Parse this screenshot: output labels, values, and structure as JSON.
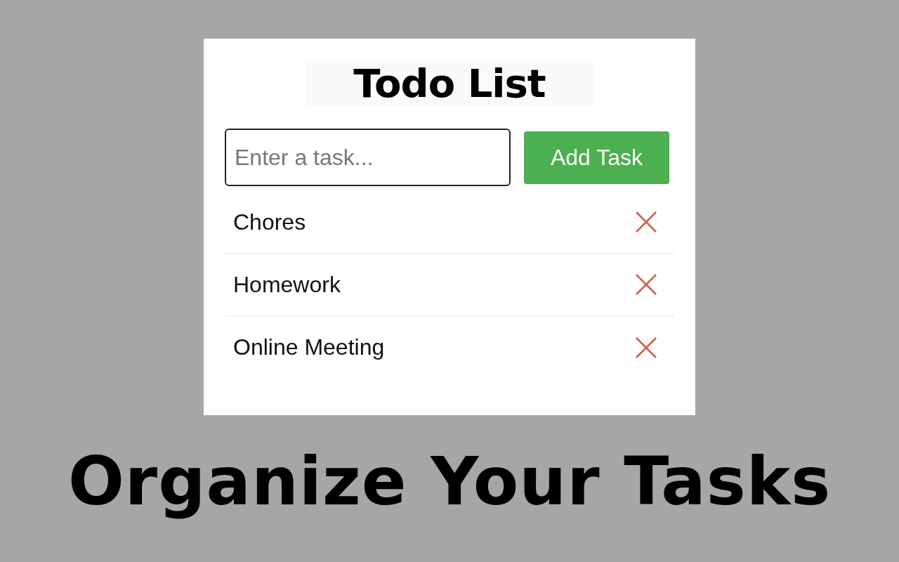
{
  "app": {
    "title": "Todo List",
    "input": {
      "placeholder": "Enter a task..."
    },
    "add_button": "Add Task",
    "tasks": [
      {
        "text": "Chores"
      },
      {
        "text": "Homework"
      },
      {
        "text": "Online Meeting"
      }
    ]
  },
  "caption": "Organize Your Tasks"
}
